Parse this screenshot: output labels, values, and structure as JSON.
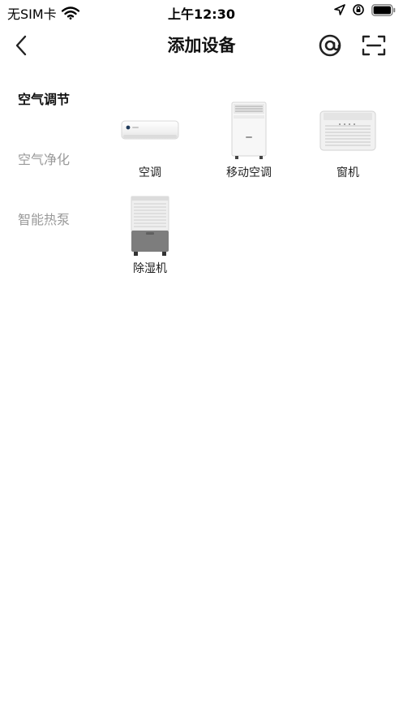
{
  "status_bar": {
    "carrier": "无SIM卡",
    "time": "上午12:30"
  },
  "header": {
    "title": "添加设备",
    "back_icon": "chevron-left-icon",
    "actions": [
      {
        "icon": "at-sign-icon"
      },
      {
        "icon": "scan-icon"
      }
    ]
  },
  "sidebar": {
    "items": [
      {
        "label": "空气调节",
        "active": true
      },
      {
        "label": "空气净化",
        "active": false
      },
      {
        "label": "智能热泵",
        "active": false
      }
    ]
  },
  "devices": [
    {
      "label": "空调",
      "icon": "split-air-conditioner-icon"
    },
    {
      "label": "移动空调",
      "icon": "portable-air-conditioner-icon"
    },
    {
      "label": "窗机",
      "icon": "window-air-conditioner-icon"
    },
    {
      "label": "除湿机",
      "icon": "dehumidifier-icon"
    }
  ],
  "colors": {
    "active_text": "#111111",
    "inactive_text": "#9a9a9a",
    "background": "#ffffff"
  }
}
